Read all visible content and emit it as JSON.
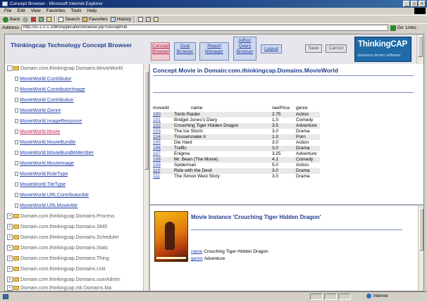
{
  "window": {
    "title": "Concept Browser - Microsoft Internet Explorer",
    "controls": [
      "_",
      "□",
      "×"
    ]
  },
  "menubar": [
    "File",
    "Edit",
    "View",
    "Favorites",
    "Tools",
    "Help"
  ],
  "toolbar": {
    "back": "Back",
    "forward": "",
    "search": "Search",
    "favorites": "Favorites",
    "history": "History"
  },
  "address": {
    "label": "Address",
    "value": "http://10.1.0.1:1080/Application/browser.jsp?concept=id",
    "go": "Go",
    "links": "Links"
  },
  "app": {
    "title": "Thinkingcap Technology Concept Browser",
    "nav": [
      {
        "label": "Concept Browser",
        "active": true
      },
      {
        "label": "Goal Browser",
        "active": false
      },
      {
        "label": "Report Manager",
        "active": false
      },
      {
        "label": "Adhoc Query Browser",
        "active": false
      },
      {
        "label": "Logout",
        "active": false
      }
    ],
    "save": "Save",
    "cancel": "Cancel",
    "logo_main": "ThinkingCAP",
    "logo_sub": "business driven software"
  },
  "tree": {
    "root": "Domain.com.thinkingcap.Domains.MovieWorld",
    "children": [
      "MovieWorld.Contributor",
      "MovieWorld.ContributorImage",
      "MovieWorld.Contribution",
      "MovieWorld.Genre",
      "MovieWorld.ImageResource",
      "MovieWorld.Movie",
      "MovieWorld.MovieBundle",
      "MovieWorld.MovieBundleMember",
      "MovieWorld.MovieImage",
      "MovieWorld.RoleType",
      "MovieWorld.TileType",
      "MovieWorld.URLContributorAttr",
      "MovieWorld.URLMovieAttr"
    ],
    "selected_index": 5,
    "siblings": [
      "Domain.com.thinkingcap.Domains.Process",
      "Domain.com.thinkingcap.Domains.SMS",
      "Domain.com.thinkingcap.Domains.Scheduler",
      "Domain.com.thinkingcap.Domains.Stats",
      "Domain.com.thinkingcap.Domains.Thing",
      "Domain.com.thinkingcap.Domains.Unit",
      "Domain.com.thinkingcap.Domains.userAdmin",
      "Domain.com.thinkingcap.mk.Domains.Ma"
    ]
  },
  "movies_panel": {
    "heading": "Concept Movie in Domain:com.thinkingcap.Domains.MovieWorld",
    "columns": [
      "movieId",
      "name",
      "rawPrice",
      "genre"
    ],
    "rows": [
      [
        "100",
        "Tomb Raider",
        "2.75",
        "Action"
      ],
      [
        "101",
        "Bridget Jones's Diary",
        "1.0",
        "Comedy"
      ],
      [
        "102",
        "Crouching Tiger Hidden Dragon",
        "3.5",
        "Adventure"
      ],
      [
        "103",
        "The Ice Storm",
        "3.0",
        "Drama"
      ],
      [
        "104",
        "Trousersnake II",
        "1.0",
        "Porn"
      ],
      [
        "105",
        "Die Hard",
        "3.0",
        "Action"
      ],
      [
        "106",
        "Traffic",
        "3.0",
        "Drama"
      ],
      [
        "107",
        "Enigma",
        "3.25",
        "Adventure"
      ],
      [
        "108",
        "Mr. Bean (The Movie)",
        "4.1",
        "Comedy"
      ],
      [
        "109",
        "Spiderman",
        "5.0",
        "Action"
      ],
      [
        "110",
        "Ride with the Devil",
        "3.0",
        "Drama"
      ],
      [
        "111",
        "The Simon West Story",
        "3.0",
        "Drama"
      ]
    ]
  },
  "instance": {
    "title": "Movie Instance 'Crouching Tiger Hidden Dragon'",
    "name_key": "name",
    "name_value": "Crouching Tiger Hidden Dragon",
    "genre_key": "genre",
    "genre_value": "Adventure"
  },
  "status": {
    "zone": "Internet"
  },
  "colors": {
    "link": "#1f3ea8",
    "heading": "#203c8c",
    "selected": "#c0205a",
    "logo_bg": "#1f6aa7"
  }
}
